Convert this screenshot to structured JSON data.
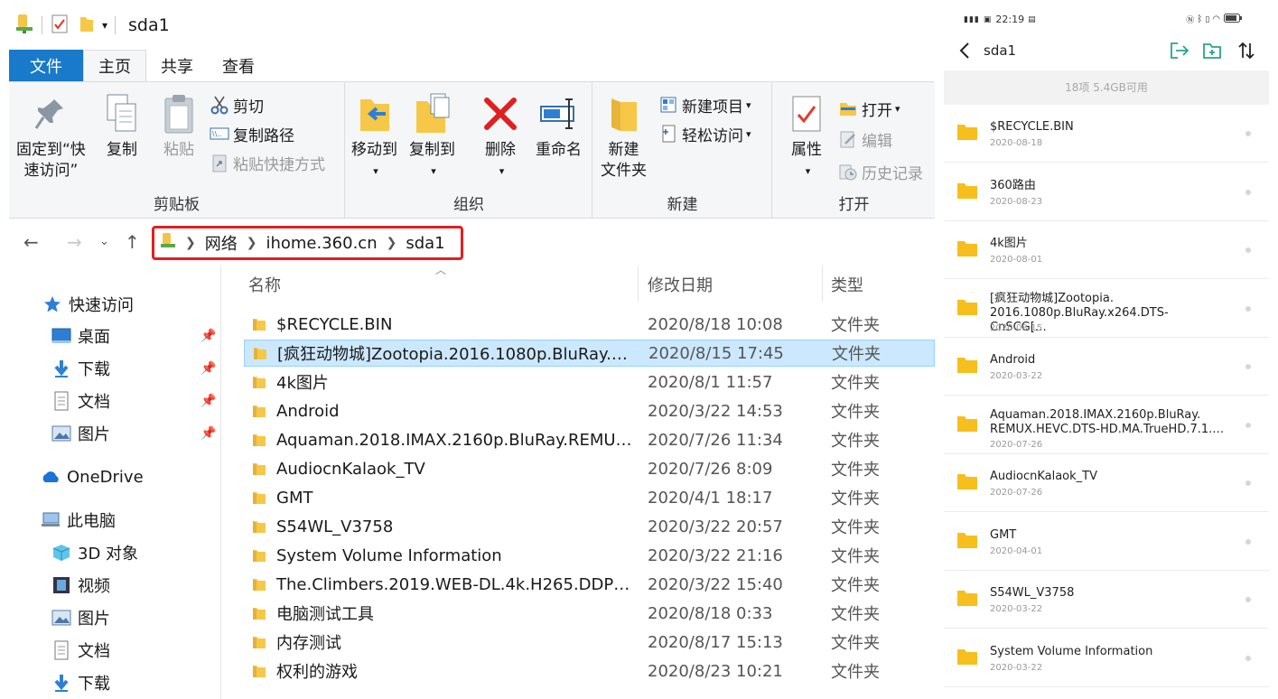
{
  "explorer": {
    "title": "sda1",
    "tabs": [
      "文件",
      "主页",
      "共享",
      "查看"
    ],
    "ribbon": {
      "clipboard": {
        "label": "剪贴板",
        "pin_line1": "固定到“快",
        "pin_line2": "速访问”",
        "copy": "复制",
        "paste": "粘贴",
        "cut": "剪切",
        "copy_path": "复制路径",
        "paste_shortcut": "粘贴快捷方式"
      },
      "organize": {
        "label": "组织",
        "move_to": "移动到",
        "copy_to": "复制到",
        "delete": "删除",
        "rename": "重命名"
      },
      "new": {
        "label": "新建",
        "new_folder_line1": "新建",
        "new_folder_line2": "文件夹",
        "new_item": "新建项目",
        "easy_access": "轻松访问"
      },
      "open": {
        "label": "打开",
        "properties": "属性",
        "open": "打开",
        "edit": "编辑",
        "history": "历史记录"
      }
    },
    "breadcrumb": [
      "网络",
      "ihome.360.cn",
      "sda1"
    ],
    "nav": {
      "quick_access": "快速访问",
      "desktop": "桌面",
      "downloads": "下载",
      "documents": "文档",
      "pictures": "图片",
      "onedrive": "OneDrive",
      "this_pc": "此电脑",
      "objects3d": "3D 对象",
      "videos": "视频",
      "pictures2": "图片",
      "documents2": "文档",
      "downloads2": "下载"
    },
    "columns": {
      "name": "名称",
      "date": "修改日期",
      "type": "类型"
    },
    "files": [
      {
        "name": "$RECYCLE.BIN",
        "date": "2020/8/18 10:08",
        "type": "文件夹"
      },
      {
        "name": "[疯狂动物城]Zootopia.2016.1080p.BluRay.x2...",
        "date": "2020/8/15 17:45",
        "type": "文件夹"
      },
      {
        "name": "4k图片",
        "date": "2020/8/1 11:57",
        "type": "文件夹"
      },
      {
        "name": "Android",
        "date": "2020/3/22 14:53",
        "type": "文件夹"
      },
      {
        "name": "Aquaman.2018.IMAX.2160p.BluRay.REMUX...",
        "date": "2020/7/26 11:34",
        "type": "文件夹"
      },
      {
        "name": "AudiocnKalaok_TV",
        "date": "2020/7/26 8:09",
        "type": "文件夹"
      },
      {
        "name": "GMT",
        "date": "2020/4/1 18:17",
        "type": "文件夹"
      },
      {
        "name": "S54WL_V3758",
        "date": "2020/3/22 20:57",
        "type": "文件夹"
      },
      {
        "name": "System Volume Information",
        "date": "2020/3/22 21:16",
        "type": "文件夹"
      },
      {
        "name": "The.Climbers.2019.WEB-DL.4k.H265.DDP5.1...",
        "date": "2020/3/22 15:40",
        "type": "文件夹"
      },
      {
        "name": "电脑测试工具",
        "date": "2020/8/18 0:33",
        "type": "文件夹"
      },
      {
        "name": "内存测试",
        "date": "2020/8/17 15:13",
        "type": "文件夹"
      },
      {
        "name": "权利的游戏",
        "date": "2020/8/23 10:21",
        "type": "文件夹"
      }
    ]
  },
  "phone": {
    "status_time": "22:19",
    "title": "sda1",
    "storage": "18项 5.4GB可用",
    "items": [
      {
        "name": "$RECYCLE.BIN",
        "date": "2020-08-18"
      },
      {
        "name": "360路由",
        "date": "2020-08-23"
      },
      {
        "name": "4k图片",
        "date": "2020-08-01"
      },
      {
        "name": "[疯狂动物城]Zootopia.",
        "name2": "2016.1080p.BluRay.x264.DTS-CnSCG[…",
        "date": "2020-08-15"
      },
      {
        "name": "Android",
        "date": "2020-03-22"
      },
      {
        "name": "Aquaman.2018.IMAX.2160p.BluRay.",
        "name2": "REMUX.HEVC.DTS-HD.MA.TrueHD.7.1.…",
        "date": "2020-07-26"
      },
      {
        "name": "AudiocnKalaok_TV",
        "date": "2020-07-26"
      },
      {
        "name": "GMT",
        "date": "2020-04-01"
      },
      {
        "name": "S54WL_V3758",
        "date": "2020-03-22"
      },
      {
        "name": "System Volume Information",
        "date": "2020-03-22"
      }
    ]
  }
}
